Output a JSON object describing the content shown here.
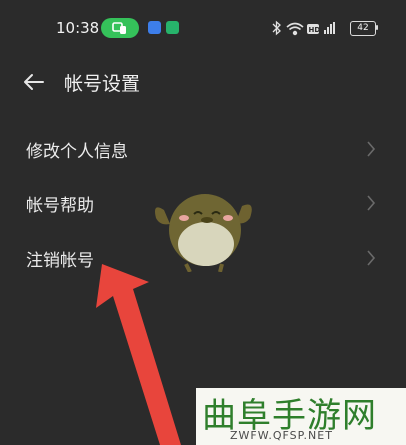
{
  "status_bar": {
    "time": "10:38",
    "battery": "42"
  },
  "header": {
    "title": "帐号设置"
  },
  "menu": {
    "items": [
      {
        "label": "修改个人信息"
      },
      {
        "label": "帐号帮助"
      },
      {
        "label": "注销帐号"
      }
    ]
  },
  "watermark": {
    "title": "曲阜手游网",
    "url": "ZWFW.QFSP.NET"
  },
  "colors": {
    "background": "#2b2b2b",
    "cast_pill": "#35c25a",
    "arrow": "#e8453c",
    "watermark_green": "#2f7f2c"
  },
  "icons": [
    "back-arrow-icon",
    "chevron-right-icon",
    "screen-cast-icon",
    "bluetooth-icon",
    "wifi-icon",
    "hd-icon",
    "signal-icon",
    "battery-icon"
  ]
}
